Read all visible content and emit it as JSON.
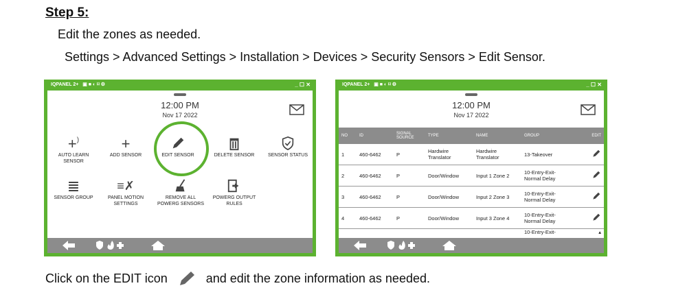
{
  "doc": {
    "step": "Step 5:",
    "instruction": "Edit the zones as needed.",
    "path": "Settings > Advanced Settings > Installation > Devices > Security Sensors > Edit Sensor.",
    "footer_before": "Click on the EDIT icon",
    "footer_after": "and edit the zone information as needed."
  },
  "panel": {
    "title": "IQPANEL 2+",
    "window_controls": "_ ☐ ✕",
    "time": "12:00 PM",
    "date": "Nov 17 2022"
  },
  "tiles": [
    {
      "label": "AUTO LEARN SENSOR",
      "icon": "plus-wifi-icon"
    },
    {
      "label": "ADD SENSOR",
      "icon": "plus-icon"
    },
    {
      "label": "EDIT SENSOR",
      "icon": "pencil-icon"
    },
    {
      "label": "DELETE SENSOR",
      "icon": "trash-icon"
    },
    {
      "label": "SENSOR STATUS",
      "icon": "shield-icon"
    },
    {
      "label": "SENSOR GROUP",
      "icon": "list-icon"
    },
    {
      "label": "PANEL MOTION SETTINGS",
      "icon": "running-icon"
    },
    {
      "label": "REMOVE ALL POWERG SENSORS",
      "icon": "broom-icon"
    },
    {
      "label": "POWERG OUTPUT RULES",
      "icon": "exit-icon"
    }
  ],
  "table": {
    "headers": [
      "NO",
      "ID",
      "SIGNAL SOURCE",
      "TYPE",
      "NAME",
      "GROUP",
      "EDIT"
    ],
    "rows": [
      [
        "1",
        "460-6462",
        "P",
        "Hardwire Translator",
        "Hardwire Translator",
        "13-Takeover"
      ],
      [
        "2",
        "460-6462",
        "P",
        "Door/Window",
        "Input 1 Zone 2",
        "10-Entry-Exit-Normal Delay"
      ],
      [
        "3",
        "460-6462",
        "P",
        "Door/Window",
        "Input 2 Zone 3",
        "10-Entry-Exit-Normal Delay"
      ],
      [
        "4",
        "460-6462",
        "P",
        "Door/Window",
        "Input 3 Zone 4",
        "10-Entry-Exit-Normal Delay"
      ]
    ],
    "partial_group": "10-Entry-Exit-"
  },
  "colors": {
    "panel_green": "#5cb230",
    "bar_gray": "#8c8c8c"
  }
}
